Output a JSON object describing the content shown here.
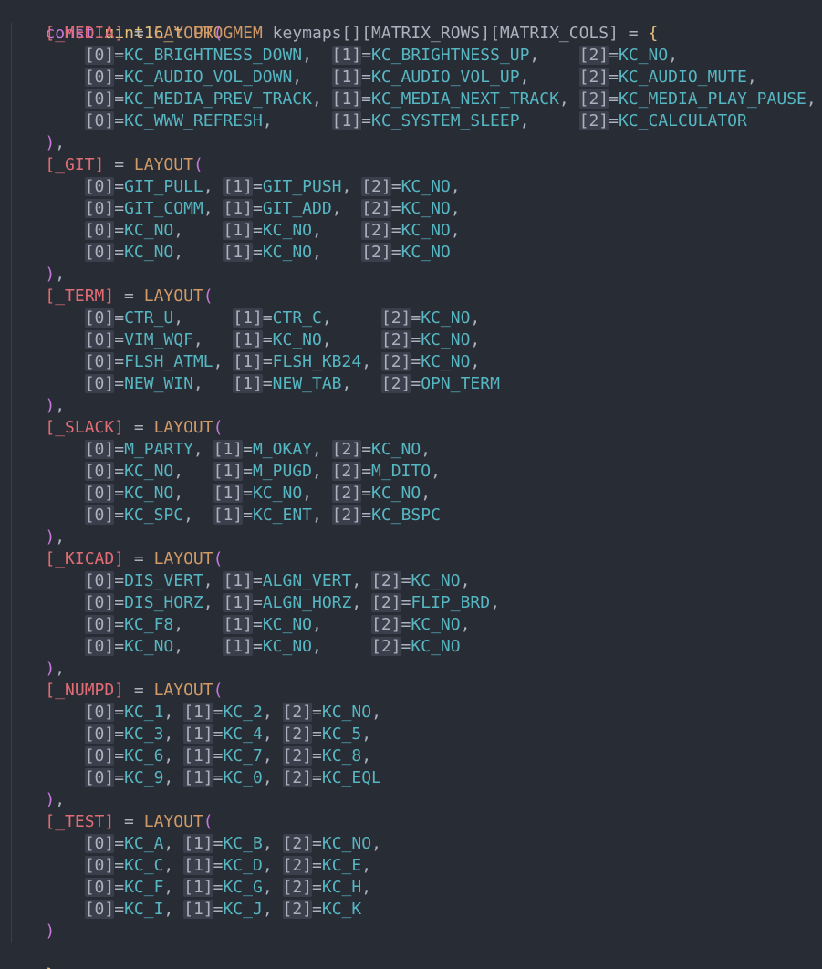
{
  "header": {
    "kw": "const",
    "type": "uint16_t",
    "macro": "PROGMEM",
    "name": "keymaps",
    "dims": "[]",
    "rows": "[MATRIX_ROWS]",
    "cols": "[MATRIX_COLS]",
    "eq": " = ",
    "open": "{"
  },
  "layers": [
    {
      "label": "[_MEDIA]",
      "rows": [
        [
          "KC_BRIGHTNESS_DOWN",
          "KC_BRIGHTNESS_UP",
          "KC_NO"
        ],
        [
          "KC_AUDIO_VOL_DOWN",
          "KC_AUDIO_VOL_UP",
          "KC_AUDIO_MUTE"
        ],
        [
          "KC_MEDIA_PREV_TRACK",
          "KC_MEDIA_NEXT_TRACK",
          "KC_MEDIA_PLAY_PAUSE"
        ],
        [
          "KC_WWW_REFRESH",
          "KC_SYSTEM_SLEEP",
          "KC_CALCULATOR"
        ]
      ]
    },
    {
      "label": "[_GIT]",
      "rows": [
        [
          "GIT_PULL",
          "GIT_PUSH",
          "KC_NO"
        ],
        [
          "GIT_COMM",
          "GIT_ADD",
          "KC_NO"
        ],
        [
          "KC_NO",
          "KC_NO",
          "KC_NO"
        ],
        [
          "KC_NO",
          "KC_NO",
          "KC_NO"
        ]
      ]
    },
    {
      "label": "[_TERM]",
      "rows": [
        [
          "CTR_U",
          "CTR_C",
          "KC_NO"
        ],
        [
          "VIM_WQF",
          "KC_NO",
          "KC_NO"
        ],
        [
          "FLSH_ATML",
          "FLSH_KB24",
          "KC_NO"
        ],
        [
          "NEW_WIN",
          "NEW_TAB",
          "OPN_TERM"
        ]
      ]
    },
    {
      "label": "[_SLACK]",
      "rows": [
        [
          "M_PARTY",
          "M_OKAY",
          "KC_NO"
        ],
        [
          "KC_NO",
          "M_PUGD",
          "M_DITO"
        ],
        [
          "KC_NO",
          "KC_NO",
          "KC_NO"
        ],
        [
          "KC_SPC",
          "KC_ENT",
          "KC_BSPC"
        ]
      ]
    },
    {
      "label": "[_KICAD]",
      "rows": [
        [
          "DIS_VERT",
          "ALGN_VERT",
          "KC_NO"
        ],
        [
          "DIS_HORZ",
          "ALGN_HORZ",
          "FLIP_BRD"
        ],
        [
          "KC_F8",
          "KC_NO",
          "KC_NO"
        ],
        [
          "KC_NO",
          "KC_NO",
          "KC_NO"
        ]
      ]
    },
    {
      "label": "[_NUMPD]",
      "rows": [
        [
          "KC_1",
          "KC_2",
          "KC_NO"
        ],
        [
          "KC_3",
          "KC_4",
          "KC_5"
        ],
        [
          "KC_6",
          "KC_7",
          "KC_8"
        ],
        [
          "KC_9",
          "KC_0",
          "KC_EQL"
        ]
      ]
    },
    {
      "label": "[_TEST]",
      "rows": [
        [
          "KC_A",
          "KC_B",
          "KC_NO"
        ],
        [
          "KC_C",
          "KC_D",
          "KC_E"
        ],
        [
          "KC_F",
          "KC_G",
          "KC_H"
        ],
        [
          "KC_I",
          "KC_J",
          "KC_K"
        ]
      ]
    }
  ],
  "tokens": {
    "layout": "LAYOUT",
    "assign": " = ",
    "open_paren": "(",
    "close_paren": ")",
    "comma": ",",
    "idx": [
      "[0]",
      "[1]",
      "[2]"
    ],
    "eq": "="
  },
  "footer": "};"
}
